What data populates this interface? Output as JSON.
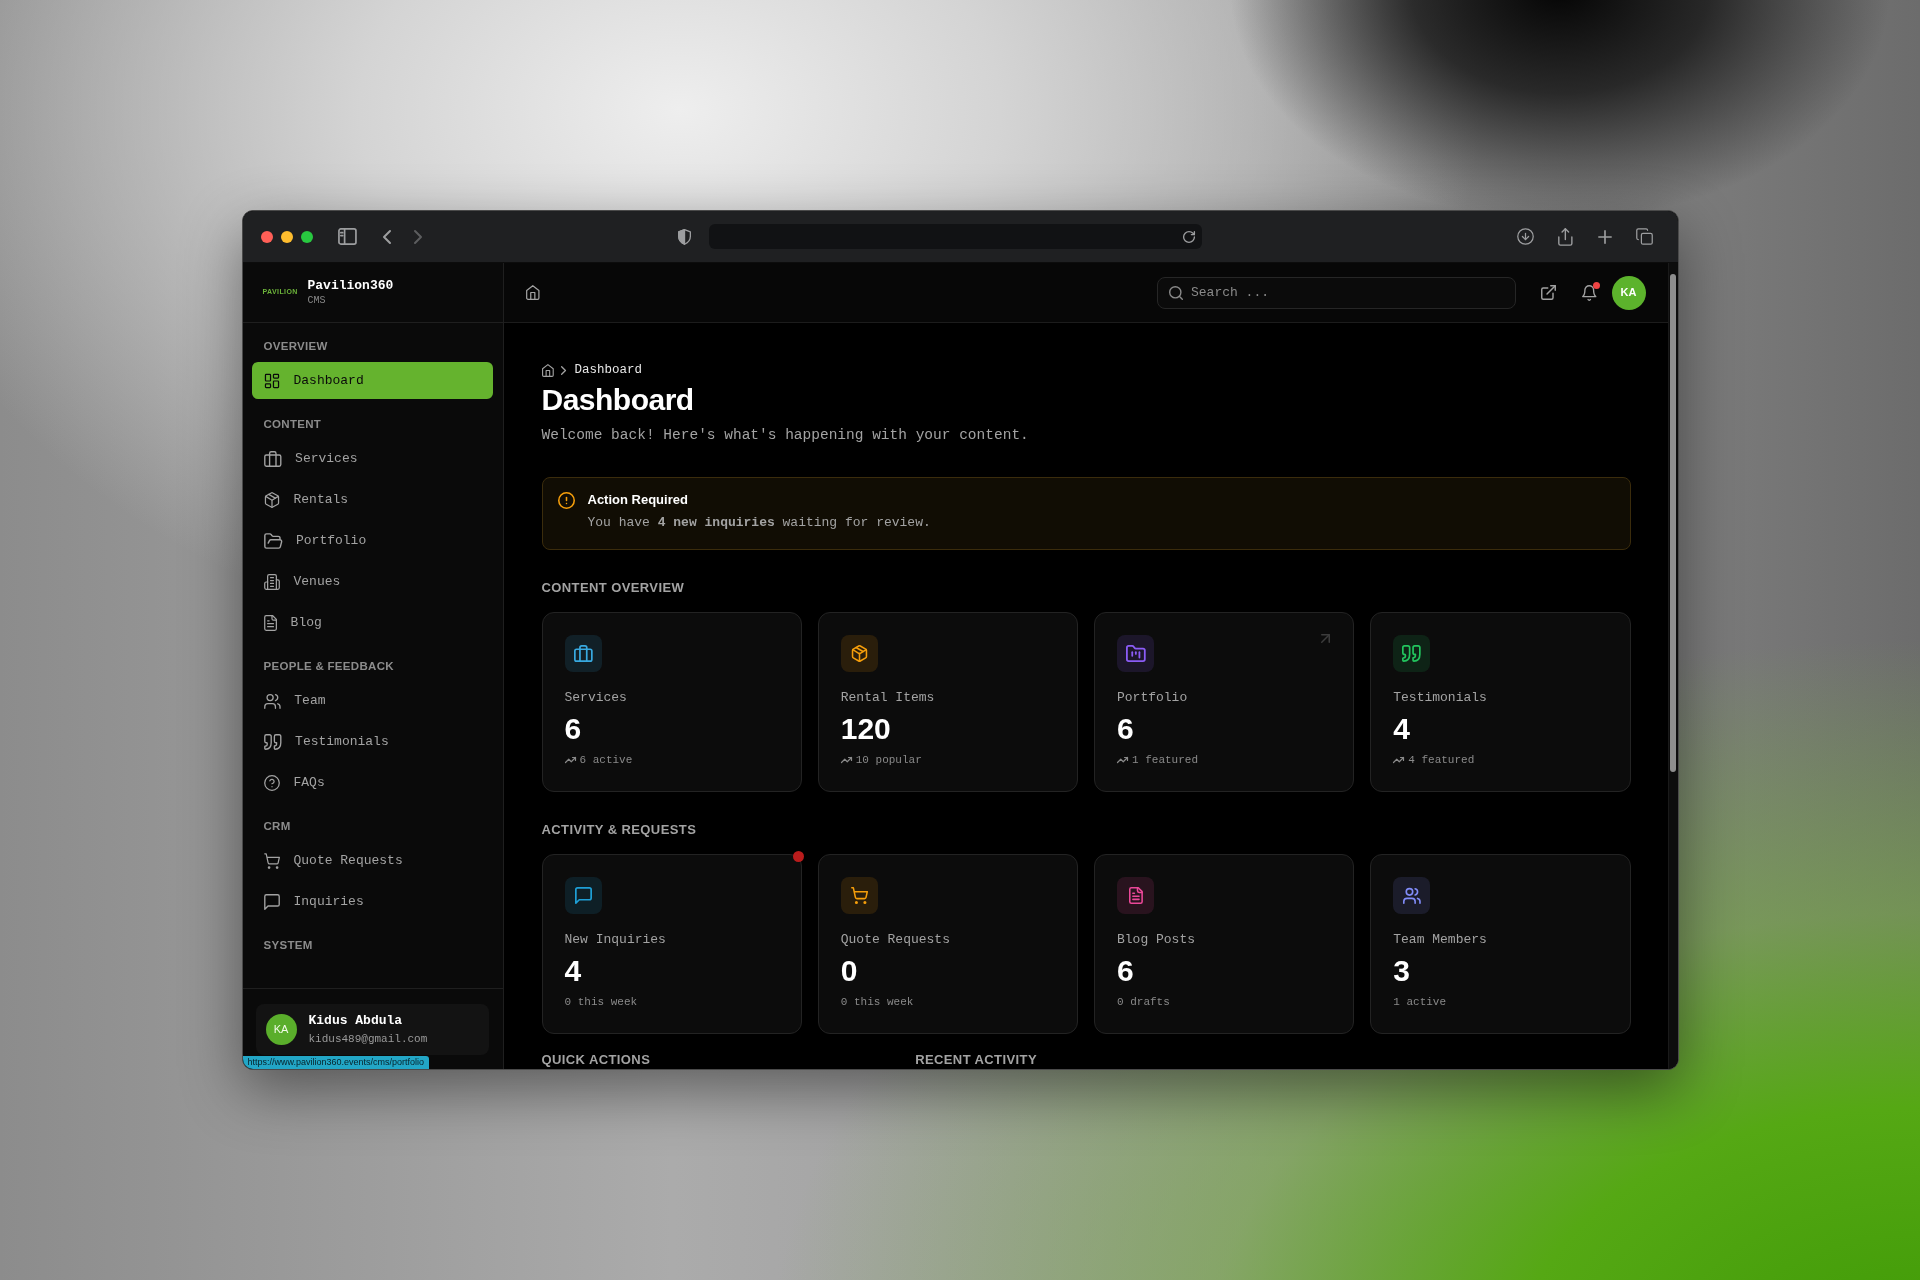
{
  "browser": {
    "link_preview": "https://www.pavilion360.events/cms/portfolio"
  },
  "sidebar": {
    "brand": {
      "logo": "PAVILION",
      "name": "Pavilion360",
      "subtitle": "CMS"
    },
    "sections": [
      {
        "title": "OVERVIEW",
        "items": [
          {
            "label": "Dashboard",
            "selected": true
          }
        ]
      },
      {
        "title": "CONTENT",
        "items": [
          {
            "label": "Services",
            "selected": false
          },
          {
            "label": "Rentals",
            "selected": false
          },
          {
            "label": "Portfolio",
            "selected": false
          },
          {
            "label": "Venues",
            "selected": false
          },
          {
            "label": "Blog",
            "selected": false
          }
        ]
      },
      {
        "title": "PEOPLE & FEEDBACK",
        "items": [
          {
            "label": "Team",
            "selected": false
          },
          {
            "label": "Testimonials",
            "selected": false
          },
          {
            "label": "FAQs",
            "selected": false
          }
        ]
      },
      {
        "title": "CRM",
        "items": [
          {
            "label": "Quote Requests",
            "selected": false
          },
          {
            "label": "Inquiries",
            "selected": false
          }
        ]
      },
      {
        "title": "SYSTEM"
      }
    ],
    "user": {
      "initials": "KA",
      "name": "Kidus Abdula",
      "email": "kidus489@gmail.com"
    }
  },
  "header": {
    "search": {
      "placeholder": "Search ..."
    },
    "bell": {
      "unread": true
    },
    "avatar": "KA"
  },
  "breadcrumb": {
    "current": "Dashboard"
  },
  "page": {
    "title": "Dashboard",
    "subtitle": "Welcome back! Here's what's happening with your content."
  },
  "alert": {
    "title": "Action Required",
    "text": "You have **4 new inquiries** waiting for review."
  },
  "content_overview": {
    "title": "CONTENT OVERVIEW",
    "cards": [
      {
        "label": "Services",
        "value": "6",
        "detail": "6 active",
        "trend": true,
        "color": "#38a9e0",
        "hovered": false,
        "notify": false
      },
      {
        "label": "Rental Items",
        "value": "120",
        "detail": "10 popular",
        "trend": true,
        "color": "#f59e0b",
        "hovered": false,
        "notify": false
      },
      {
        "label": "Portfolio",
        "value": "6",
        "detail": "1 featured",
        "trend": true,
        "color": "#8b5cf6",
        "hovered": true,
        "notify": false
      },
      {
        "label": "Testimonials",
        "value": "4",
        "detail": "4 featured",
        "trend": true,
        "color": "#22c55e",
        "hovered": false,
        "notify": false
      }
    ]
  },
  "activity_requests": {
    "title": "ACTIVITY & REQUESTS",
    "cards": [
      {
        "label": "New Inquiries",
        "value": "4",
        "detail": "0 this week",
        "trend": false,
        "color": "#1e9fd6",
        "hovered": false,
        "notify": true
      },
      {
        "label": "Quote Requests",
        "value": "0",
        "detail": "0 this week",
        "trend": false,
        "color": "#f59e0b",
        "hovered": false,
        "notify": false
      },
      {
        "label": "Blog Posts",
        "value": "6",
        "detail": "0 drafts",
        "trend": false,
        "color": "#ec4899",
        "hovered": false,
        "notify": false
      },
      {
        "label": "Team Members",
        "value": "3",
        "detail": "1 active",
        "trend": false,
        "color": "#818cf8",
        "hovered": false,
        "notify": false
      }
    ]
  },
  "bottom_sections": [
    {
      "title": "QUICK ACTIONS"
    },
    {
      "title": "RECENT ACTIVITY"
    }
  ]
}
